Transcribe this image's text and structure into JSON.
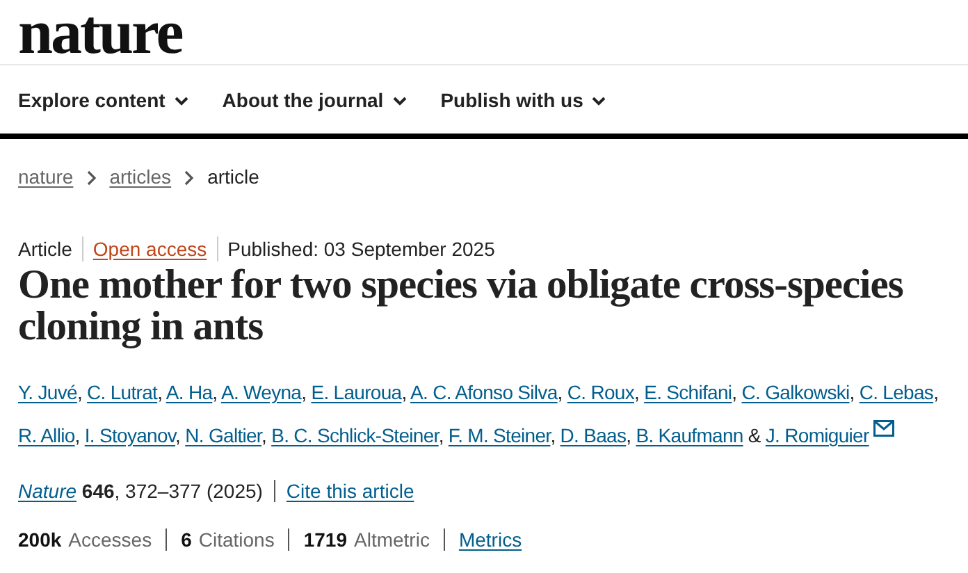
{
  "logo": "nature",
  "nav": [
    {
      "label": "Explore content"
    },
    {
      "label": "About the journal"
    },
    {
      "label": "Publish with us"
    }
  ],
  "breadcrumb": [
    {
      "label": "nature",
      "kind": "link"
    },
    {
      "label": "articles",
      "kind": "link"
    },
    {
      "label": "article",
      "kind": "current"
    }
  ],
  "meta": {
    "type": "Article",
    "access": "Open access",
    "published": "Published: 03 September 2025"
  },
  "title": "One mother for two species via obligate cross-species cloning in ants",
  "authors": [
    {
      "name": "Y. Juvé",
      "corresponding": false
    },
    {
      "name": "C. Lutrat",
      "corresponding": false
    },
    {
      "name": "A. Ha",
      "corresponding": false
    },
    {
      "name": "A. Weyna",
      "corresponding": false
    },
    {
      "name": "E. Lauroua",
      "corresponding": false
    },
    {
      "name": "A. C. Afonso Silva",
      "corresponding": false
    },
    {
      "name": "C. Roux",
      "corresponding": false
    },
    {
      "name": "E. Schifani",
      "corresponding": false
    },
    {
      "name": "C. Galkowski",
      "corresponding": false
    },
    {
      "name": "C. Lebas",
      "corresponding": false
    },
    {
      "name": "R. Allio",
      "corresponding": false
    },
    {
      "name": "I. Stoyanov",
      "corresponding": false
    },
    {
      "name": "N. Galtier",
      "corresponding": false
    },
    {
      "name": "B. C. Schlick-Steiner",
      "corresponding": false
    },
    {
      "name": "F. M. Steiner",
      "corresponding": false
    },
    {
      "name": "D. Baas",
      "corresponding": false
    },
    {
      "name": "B. Kaufmann",
      "corresponding": false
    },
    {
      "name": "J. Romiguier",
      "corresponding": true
    }
  ],
  "authors_separator": ",",
  "authors_conjunction": "&",
  "citation": {
    "journal": "Nature",
    "volume": "646",
    "pages": ", 372–377 (2025)",
    "cite_link": "Cite this article"
  },
  "metrics": [
    {
      "count": "200k",
      "unit": "Accesses"
    },
    {
      "count": "6",
      "unit": "Citations"
    },
    {
      "count": "1719",
      "unit": "Altmetric"
    }
  ],
  "metrics_link": "Metrics"
}
